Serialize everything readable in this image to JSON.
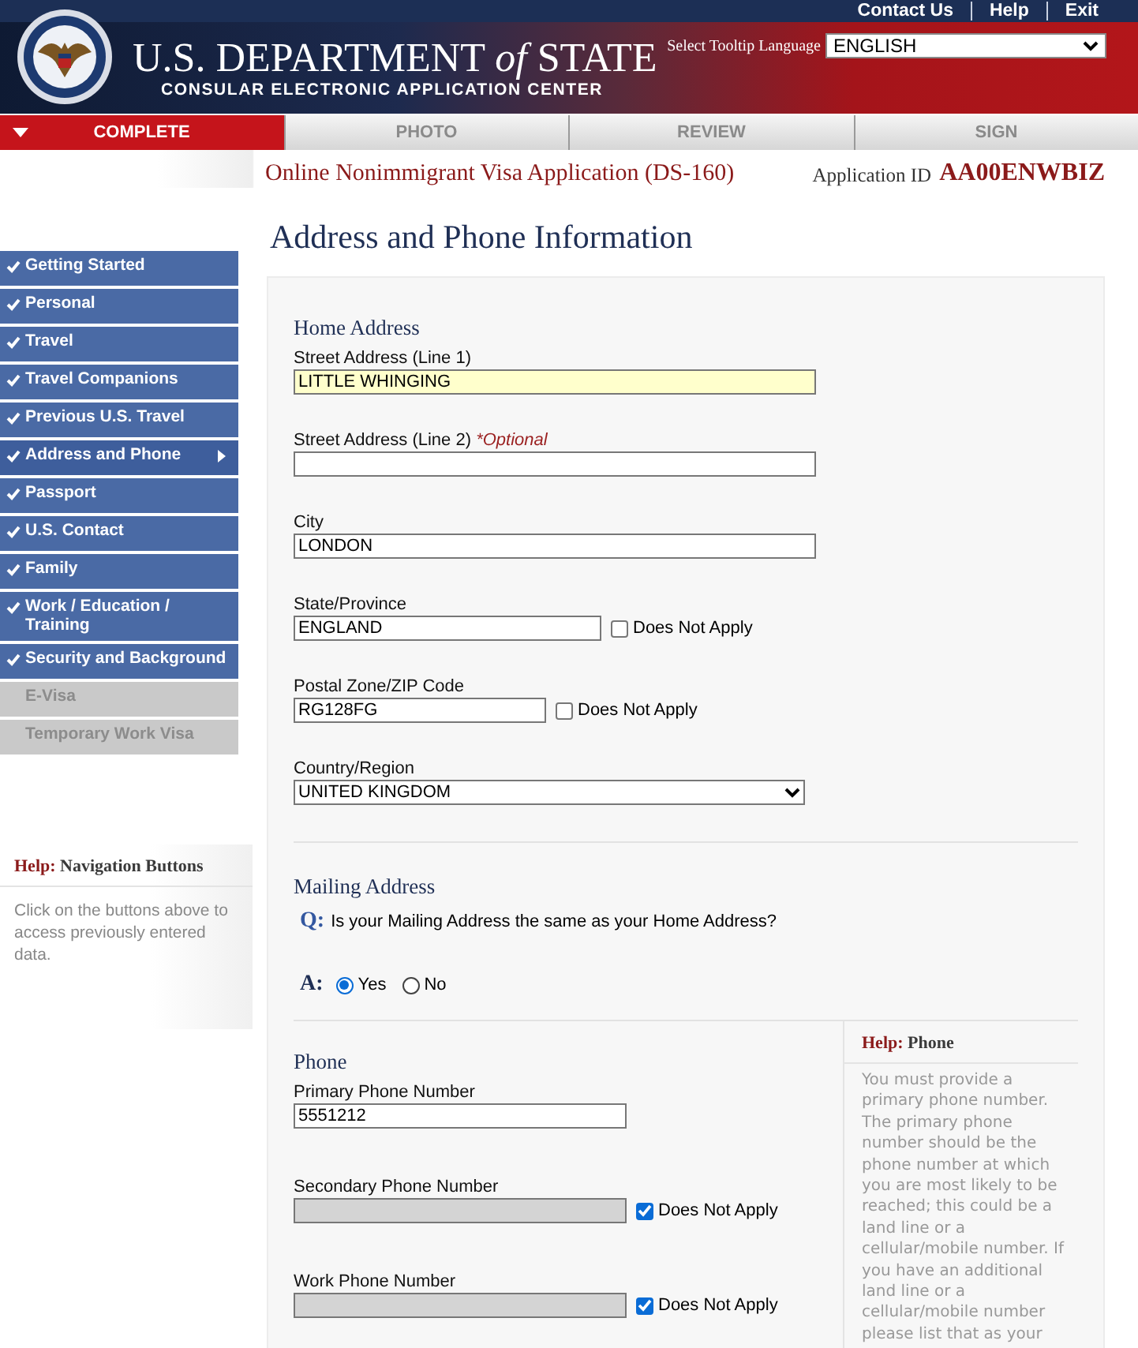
{
  "header": {
    "top_links": [
      "Contact Us",
      "Help",
      "Exit"
    ],
    "title": "U.S. DEPARTMENT *of* STATE",
    "subtitle": "CONSULAR ELECTRONIC APPLICATION CENTER",
    "language_label": "Select Tooltip Language",
    "language_value": "ENGLISH"
  },
  "tabs": [
    {
      "label": "COMPLETE",
      "selected": true
    },
    {
      "label": "PHOTO",
      "selected": false
    },
    {
      "label": "REVIEW",
      "selected": false
    },
    {
      "label": "SIGN",
      "selected": false
    }
  ],
  "application": {
    "title": "Online Nonimmigrant Visa Application (DS-160)",
    "id_label": "Application ID",
    "id_value": "AA00ENWBIZ"
  },
  "sidebar": {
    "items": [
      {
        "label": "Getting Started",
        "completed": true,
        "selected": false,
        "disabled": false
      },
      {
        "label": "Personal",
        "completed": true,
        "selected": false,
        "disabled": false
      },
      {
        "label": "Travel",
        "completed": true,
        "selected": false,
        "disabled": false
      },
      {
        "label": "Travel Companions",
        "completed": true,
        "selected": false,
        "disabled": false
      },
      {
        "label": "Previous U.S. Travel",
        "completed": true,
        "selected": false,
        "disabled": false
      },
      {
        "label": "Address and Phone",
        "completed": true,
        "selected": true,
        "disabled": false
      },
      {
        "label": "Passport",
        "completed": true,
        "selected": false,
        "disabled": false
      },
      {
        "label": "U.S. Contact",
        "completed": true,
        "selected": false,
        "disabled": false
      },
      {
        "label": "Family",
        "completed": true,
        "selected": false,
        "disabled": false
      },
      {
        "label": "Work / Education / Training",
        "completed": true,
        "selected": false,
        "disabled": false
      },
      {
        "label": "Security and Background",
        "completed": true,
        "selected": false,
        "disabled": false
      },
      {
        "label": "E-Visa",
        "completed": false,
        "selected": false,
        "disabled": true
      },
      {
        "label": "Temporary Work Visa",
        "completed": false,
        "selected": false,
        "disabled": true
      }
    ],
    "help": {
      "prefix": "Help:",
      "title": "Navigation Buttons",
      "text": "Click on the buttons above to access previously entered data."
    }
  },
  "page_title": "Address and Phone Information",
  "home_address": {
    "title": "Home Address",
    "fields": [
      {
        "kind": "text",
        "label": "Street Address (Line 1)",
        "value": "LITTLE WHINGING",
        "focused": true
      },
      {
        "kind": "text",
        "label": "Street Address (Line 2)",
        "optional": "*Optional",
        "focused": false
      },
      {
        "kind": "text",
        "label": "City",
        "value": "LONDON",
        "focused": false
      },
      {
        "kind": "text",
        "label": "State/Province",
        "value": "ENGLAND",
        "focused": false,
        "does_not_apply": {
          "label": "Does Not Apply",
          "checked": false
        }
      },
      {
        "kind": "text",
        "label": "Postal Zone/ZIP Code",
        "value": "RG128FG",
        "focused": false,
        "does_not_apply": {
          "label": "Does Not Apply",
          "checked": false
        }
      },
      {
        "kind": "select",
        "label": "Country/Region",
        "value": "UNITED KINGDOM",
        "focused": false
      }
    ]
  },
  "mailing_address": {
    "title": "Mailing Address",
    "q_mark": "Q:",
    "question": "Is your Mailing Address the same as your Home Address?",
    "a_mark": "A:",
    "options": [
      {
        "label": "Yes",
        "selected": true
      },
      {
        "label": "No",
        "selected": false
      }
    ]
  },
  "phone": {
    "title": "Phone",
    "fields": [
      {
        "kind": "text",
        "label": "Primary Phone Number",
        "value": "5551212",
        "disabled": false
      },
      {
        "kind": "text",
        "label": "Secondary Phone Number",
        "disabled": true,
        "does_not_apply": {
          "label": "Does Not Apply",
          "checked": true
        }
      },
      {
        "kind": "text",
        "label": "Work Phone Number",
        "disabled": true,
        "does_not_apply": {
          "label": "Does Not Apply",
          "checked": true
        }
      }
    ],
    "help": {
      "prefix": "Help:",
      "title": "Phone",
      "text": "You must provide a primary phone number. The primary phone number should be the phone number at which you are most likely to be reached; this could be a land line or a cellular/mobile number. If you have an additional land line or a cellular/mobile number please list that as your"
    }
  }
}
